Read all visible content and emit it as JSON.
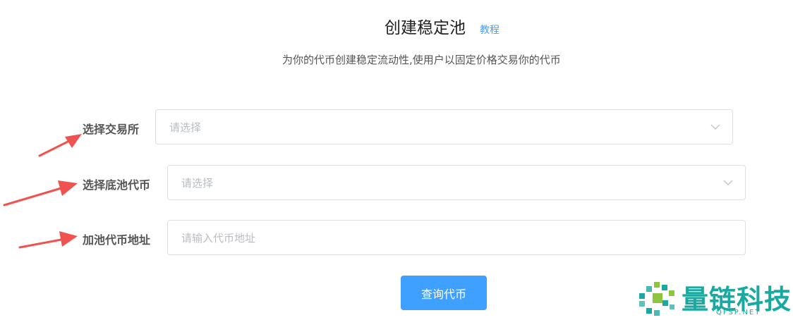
{
  "header": {
    "title": "创建稳定池",
    "tutorial_link": "教程",
    "subtitle": "为你的代币创建稳定流动性,使用户以固定价格交易你的代币"
  },
  "form": {
    "exchange": {
      "label": "选择交易所",
      "placeholder": "请选择"
    },
    "base_token": {
      "label": "选择底池代币",
      "placeholder": "请选择"
    },
    "pool_token_address": {
      "label": "加池代币地址",
      "placeholder": "请输入代币地址"
    },
    "submit_label": "查询代币"
  },
  "watermark": {
    "brand": "量链科技",
    "url": "QFSP.NET"
  },
  "colors": {
    "primary": "#409eff",
    "button": "#40a0ff",
    "arrow": "#f0524f",
    "watermark": "#1aa9a0",
    "border": "#dcdfe6"
  },
  "icons": {
    "select_chevron": "chevron-down-icon",
    "annotation_arrow": "arrow-icon",
    "logo": "chain-logo-icon"
  }
}
